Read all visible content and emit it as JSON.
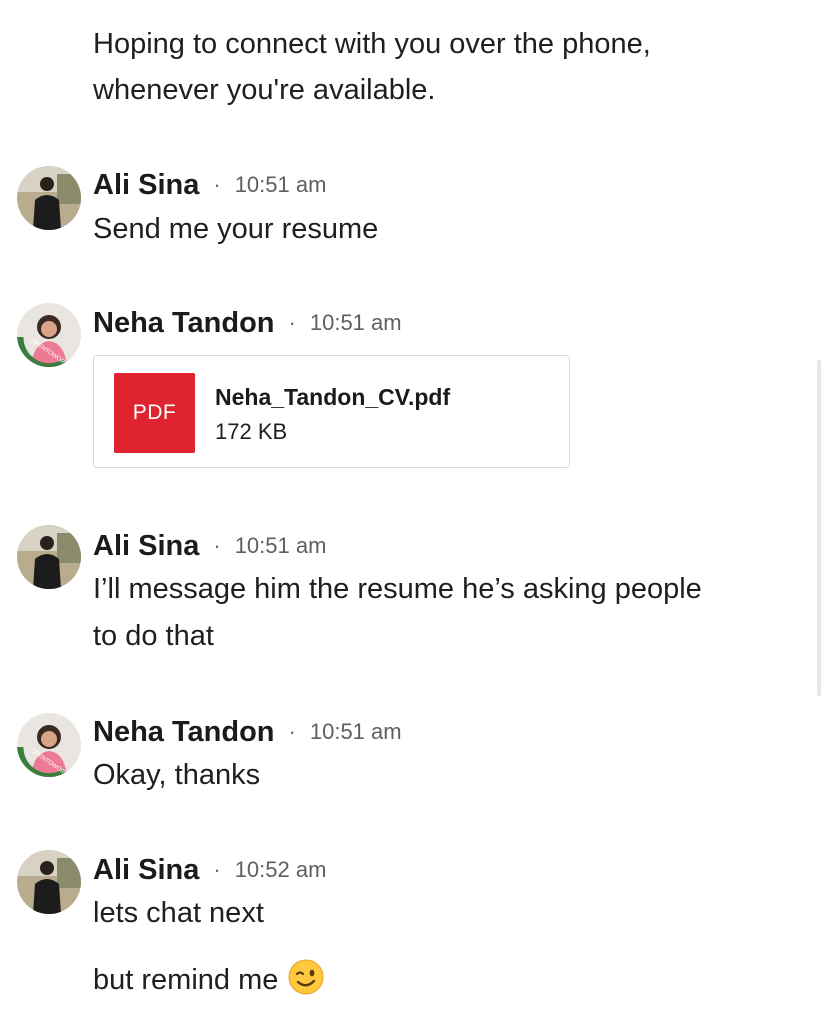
{
  "intro": {
    "line1": "Hoping to connect with you over the phone,",
    "line2": "whenever you're available."
  },
  "messages": [
    {
      "sender": "Ali Sina",
      "separator": "·",
      "time": "10:51 am",
      "text": "Send me your resume"
    },
    {
      "sender": "Neha Tandon",
      "separator": "·",
      "time": "10:51 am",
      "attachment": {
        "badge": "PDF",
        "file_name": "Neha_Tandon_CV.pdf",
        "file_size": "172 KB",
        "icon": "pdf-icon",
        "badge_color": "#e0242f"
      }
    },
    {
      "sender": "Ali Sina",
      "separator": "·",
      "time": "10:51 am",
      "text_line1": "I’ll message him the resume he’s asking people",
      "text_line2": "to do that"
    },
    {
      "sender": "Neha Tandon",
      "separator": "·",
      "time": "10:51 am",
      "text": "Okay, thanks"
    },
    {
      "sender": "Ali Sina",
      "separator": "·",
      "time": "10:52 am",
      "text": "lets chat next",
      "text2": "but remind me",
      "emoji": "winking-face-emoji"
    }
  ],
  "avatar_badge_text": "OPENTOWORK",
  "colors": {
    "open_to_work_ring": "#3a7d3c",
    "pdf_red": "#e0242f"
  }
}
